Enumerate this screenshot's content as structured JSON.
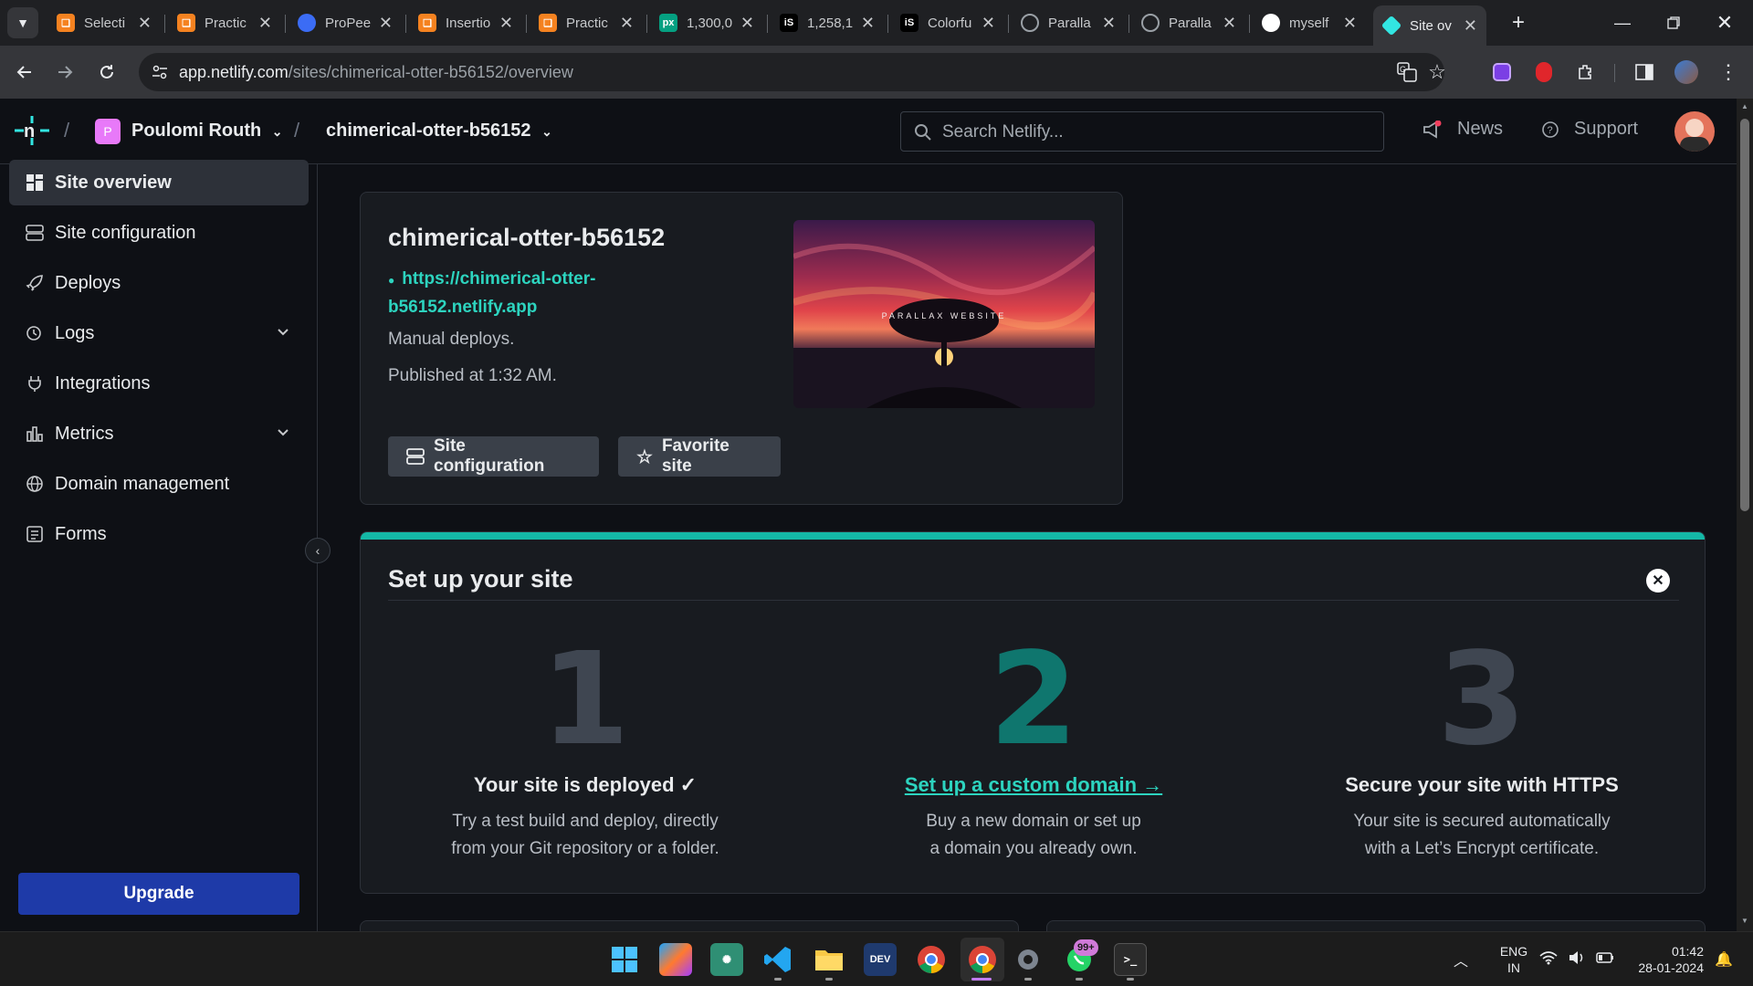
{
  "browser": {
    "tabs": [
      {
        "title": "Selecti",
        "icon": "codingninjas-icon",
        "color": "#f58220"
      },
      {
        "title": "Practic",
        "icon": "codingninjas-icon",
        "color": "#f58220"
      },
      {
        "title": "ProPee",
        "icon": "chat-bubble-icon",
        "color": "#3b6cf5"
      },
      {
        "title": "Insertio",
        "icon": "codingninjas-icon",
        "color": "#f58220"
      },
      {
        "title": "Practic",
        "icon": "codingninjas-icon",
        "color": "#f58220"
      },
      {
        "title": "1,300,0",
        "icon": "pexels-icon",
        "color": "#05a081",
        "glyph": "px"
      },
      {
        "title": "1,258,1",
        "icon": "istock-icon",
        "color": "#000000",
        "glyph": "iS"
      },
      {
        "title": "Colorfu",
        "icon": "istock-icon",
        "color": "#000000",
        "glyph": "iS"
      },
      {
        "title": "Paralla",
        "icon": "globe-icon",
        "color": "#5f6368"
      },
      {
        "title": "Paralla",
        "icon": "globe-icon",
        "color": "#5f6368"
      },
      {
        "title": "myself",
        "icon": "github-icon",
        "color": "#ffffff"
      },
      {
        "title": "Site ov",
        "icon": "netlify-icon",
        "color": "#32e6e2",
        "active": true
      }
    ],
    "url_host": "app.netlify.com",
    "url_path": "/sites/chimerical-otter-b56152/overview"
  },
  "header": {
    "team_initial": "P",
    "team_name": "Poulomi Routh",
    "site_name": "chimerical-otter-b56152",
    "search_placeholder": "Search Netlify...",
    "news_label": "News",
    "support_label": "Support"
  },
  "sidebar": {
    "items": [
      {
        "label": "Site overview",
        "icon": "grid-icon",
        "active": true
      },
      {
        "label": "Site configuration",
        "icon": "config-icon"
      },
      {
        "label": "Deploys",
        "icon": "rocket-icon"
      },
      {
        "label": "Logs",
        "icon": "logs-icon",
        "expandable": true
      },
      {
        "label": "Integrations",
        "icon": "plug-icon"
      },
      {
        "label": "Metrics",
        "icon": "bar-chart-icon",
        "expandable": true
      },
      {
        "label": "Domain management",
        "icon": "globe-icon"
      },
      {
        "label": "Forms",
        "icon": "form-icon"
      }
    ],
    "upgrade_label": "Upgrade"
  },
  "site_card": {
    "title": "chimerical-otter-b56152",
    "url_line1": "https://chimerical-otter-",
    "url_line2": "b56152.netlify.app",
    "deploy_mode": "Manual deploys.",
    "published": "Published at 1:32 AM.",
    "preview_caption": "PARALLAX WEBSITE",
    "config_button": "Site configuration",
    "favorite_button": "Favorite site"
  },
  "setup": {
    "title": "Set up your site",
    "accent_color": "#14b8a6",
    "steps": [
      {
        "number": "1",
        "heading": "Your site is deployed ✓",
        "desc_line1": "Try a test build and deploy, directly",
        "desc_line2": "from your Git repository or a folder."
      },
      {
        "number": "2",
        "heading": "Set up a custom domain →",
        "desc_line1": "Buy a new domain or set up",
        "desc_line2": "a domain you already own."
      },
      {
        "number": "3",
        "heading": "Secure your site with HTTPS",
        "desc_line1": "Your site is secured automatically",
        "desc_line2": "with a Let’s Encrypt certificate."
      }
    ]
  },
  "taskbar": {
    "lang_line1": "ENG",
    "lang_line2": "IN",
    "time": "01:42",
    "date": "28-01-2024",
    "whatsapp_badge": "99+"
  }
}
